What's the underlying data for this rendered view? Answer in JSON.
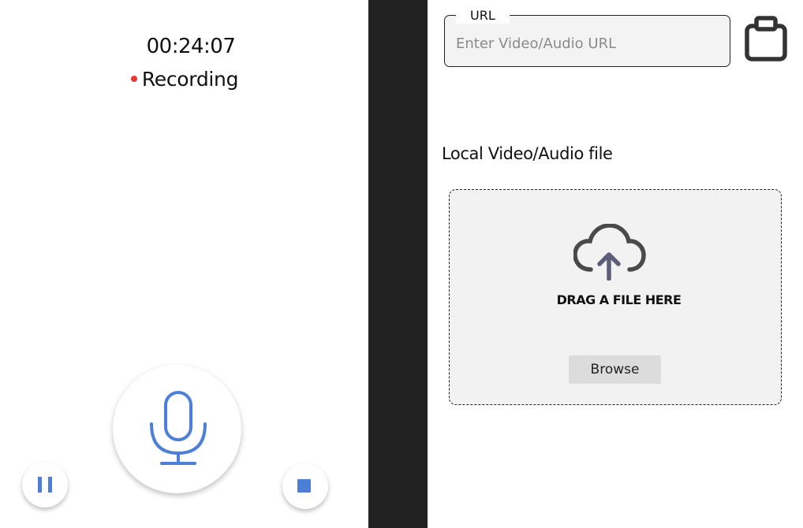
{
  "recorder": {
    "timer": "00:24:07",
    "status_label": "Recording",
    "status_color": "#e53935",
    "accent_color": "#4d7fd6",
    "mic_icon": "microphone-icon",
    "pause_icon": "pause-icon",
    "stop_icon": "stop-icon"
  },
  "import": {
    "url_legend": "URL",
    "url_placeholder": "Enter Video/Audio URL",
    "url_value": "",
    "clipboard_icon": "clipboard-icon",
    "local_title": "Local Video/Audio file",
    "upload_icon": "cloud-upload-icon",
    "drop_text": "DRAG A FILE HERE",
    "browse_label": "Browse"
  }
}
